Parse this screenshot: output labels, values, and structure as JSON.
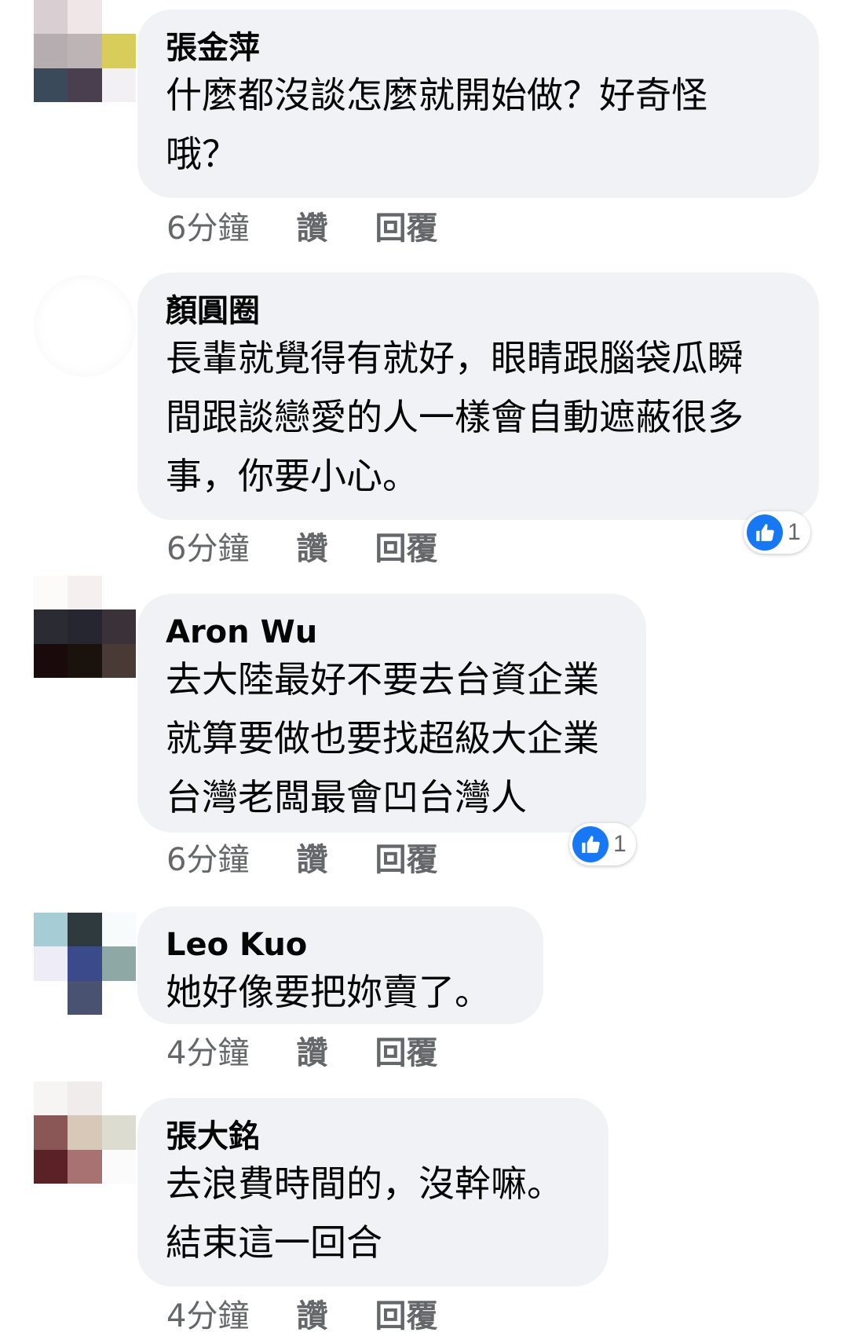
{
  "comments": [
    {
      "author": "張金萍",
      "text": "什麼都沒談怎麼就開始做？好奇怪\n哦？",
      "time": "6分鐘",
      "like_label": "讚",
      "reply_label": "回覆"
    },
    {
      "author": "顏圓圈",
      "text": "長輩就覺得有就好，眼睛跟腦袋瓜瞬\n間跟談戀愛的人一樣會自動遮蔽很多\n事，你要小心。",
      "time": "6分鐘",
      "like_label": "讚",
      "reply_label": "回覆",
      "reaction_count": "1",
      "reaction_icon": "like-icon"
    },
    {
      "author": "Aron Wu",
      "text": "去大陸最好不要去台資企業\n就算要做也要找超級大企業\n台灣老闆最會凹台灣人",
      "time": "6分鐘",
      "like_label": "讚",
      "reply_label": "回覆",
      "reaction_count": "1",
      "reaction_icon": "like-icon"
    },
    {
      "author": "Leo Kuo",
      "text": "她好像要把妳賣了。",
      "time": "4分鐘",
      "like_label": "讚",
      "reply_label": "回覆"
    },
    {
      "author": "張大銘",
      "text": "去浪費時間的，沒幹嘛。\n結束這一回合",
      "time": "4分鐘",
      "like_label": "讚",
      "reply_label": "回覆"
    }
  ],
  "colors": {
    "bubble": "#f0f2f5",
    "meta_text": "#65676b",
    "like_blue": "#1877f2"
  }
}
